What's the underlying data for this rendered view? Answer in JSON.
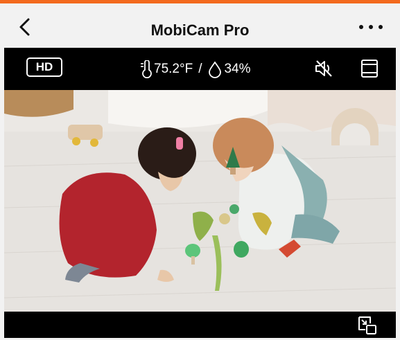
{
  "header": {
    "title": "MobiCam Pro",
    "back_icon": "chevron-left-icon",
    "more_icon": "more-horizontal-icon"
  },
  "controls": {
    "quality_label": "HD",
    "temperature": "75.2°F",
    "separator": "/",
    "humidity": "34%",
    "temperature_icon": "thermometer-icon",
    "humidity_icon": "droplet-icon",
    "mute_icon": "speaker-muted-icon",
    "layout_icon": "layout-split-icon"
  },
  "video": {
    "scene": "live-camera-feed"
  },
  "footer": {
    "pip_icon": "picture-in-picture-icon"
  },
  "colors": {
    "accent": "#f36a1e",
    "header_bg": "#f2f2f2",
    "bar_bg": "#000000"
  }
}
